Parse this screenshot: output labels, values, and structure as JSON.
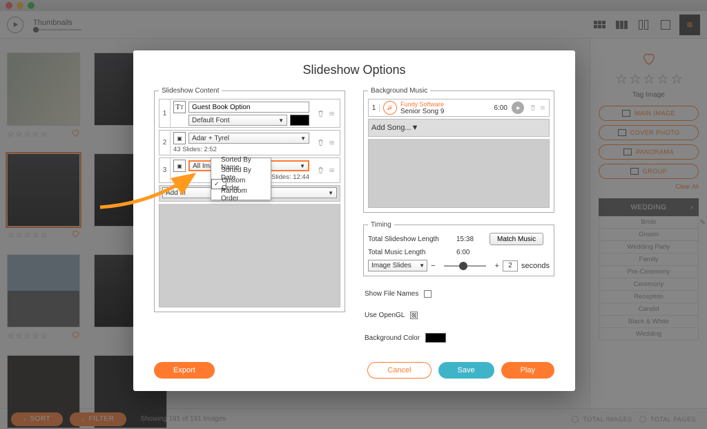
{
  "titlebar": {},
  "toolbar": {
    "thumbnails_label": "Thumbnails"
  },
  "right_panel": {
    "tag_image": "Tag Image",
    "buttons": [
      "MAIN IMAGE",
      "COVER PHOTO",
      "PANORAMA",
      "GROUP"
    ],
    "clear": "Clear All",
    "category": "WEDDING",
    "items": [
      "Bride",
      "Groom",
      "Wedding Party",
      "Family",
      "Pre-Ceremony",
      "Ceremony",
      "Reception",
      "Candid",
      "Black & White",
      "Wedding"
    ]
  },
  "footer": {
    "sort": "SORT",
    "filter": "FILTER",
    "showing": "Showing 191 of 191 Images",
    "total_images": "TOTAL IMAGES",
    "total_pages": "TOTAL PAGES"
  },
  "modal": {
    "title": "Slideshow Options",
    "content_legend": "Slideshow Content",
    "rows": [
      {
        "n": "1",
        "label": "Guest Book Option",
        "font": "Default Font"
      },
      {
        "n": "2",
        "title": "Adar + Tyrel",
        "meta": "43 Slides: 2:52"
      },
      {
        "n": "3",
        "label": "All Images",
        "meta": "191 Slides: 12:44"
      }
    ],
    "menu": [
      "Sorted By Name",
      "Sorted By Date",
      "Custom Order",
      "Random Order"
    ],
    "menu_checked_index": 2,
    "add_media": "Add M",
    "music_legend": "Background Music",
    "song": {
      "n": "1",
      "artist": "Fundy Software",
      "title": "Senior Song 9",
      "dur": "6:00"
    },
    "add_song": "Add Song...",
    "timing_legend": "Timing",
    "timing": {
      "slideshow_label": "Total Slideshow Length",
      "slideshow_val": "15:38",
      "music_label": "Total Music Length",
      "music_val": "6:00",
      "match": "Match Music",
      "selector": "Image Slides",
      "step_val": "2",
      "seconds": "seconds"
    },
    "show_file_names": "Show File Names",
    "use_opengl": "Use OpenGL",
    "bg_color": "Background Color",
    "export": "Export",
    "cancel": "Cancel",
    "save": "Save",
    "play": "Play"
  }
}
